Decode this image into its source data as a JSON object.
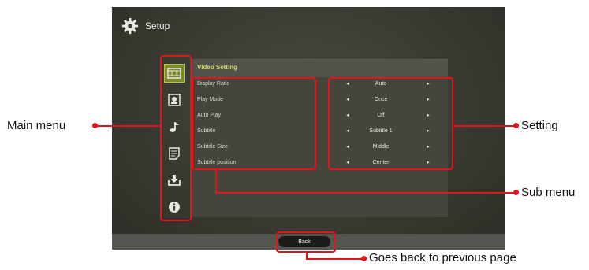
{
  "header": {
    "title": "Setup",
    "icon": "gear-icon"
  },
  "main_menu": [
    {
      "icon": "film-icon",
      "active": true
    },
    {
      "icon": "photo-icon",
      "active": false
    },
    {
      "icon": "music-note-icon",
      "active": false
    },
    {
      "icon": "document-icon",
      "active": false
    },
    {
      "icon": "download-icon",
      "active": false
    },
    {
      "icon": "info-icon",
      "active": false
    }
  ],
  "panel": {
    "title": "Video Setting",
    "rows": [
      {
        "label": "Display Ratio",
        "value": "Auto"
      },
      {
        "label": "Play Mode",
        "value": "Once"
      },
      {
        "label": "Auto Play",
        "value": "Off"
      },
      {
        "label": "Subtitle",
        "value": "Subtitle 1"
      },
      {
        "label": "Subtitle Size",
        "value": "Middle"
      },
      {
        "label": "Subtitle position",
        "value": "Center"
      }
    ],
    "arrow_left": "◄",
    "arrow_right": "►"
  },
  "footer": {
    "back_label": "Back"
  },
  "callouts": {
    "main_menu": "Main menu",
    "setting": "Setting",
    "sub_menu": "Sub menu",
    "back": "Goes back to previous page"
  },
  "colors": {
    "highlight": "#e5141a",
    "accent_title": "#d7d96a",
    "active_menu": "#7c8a2a"
  }
}
